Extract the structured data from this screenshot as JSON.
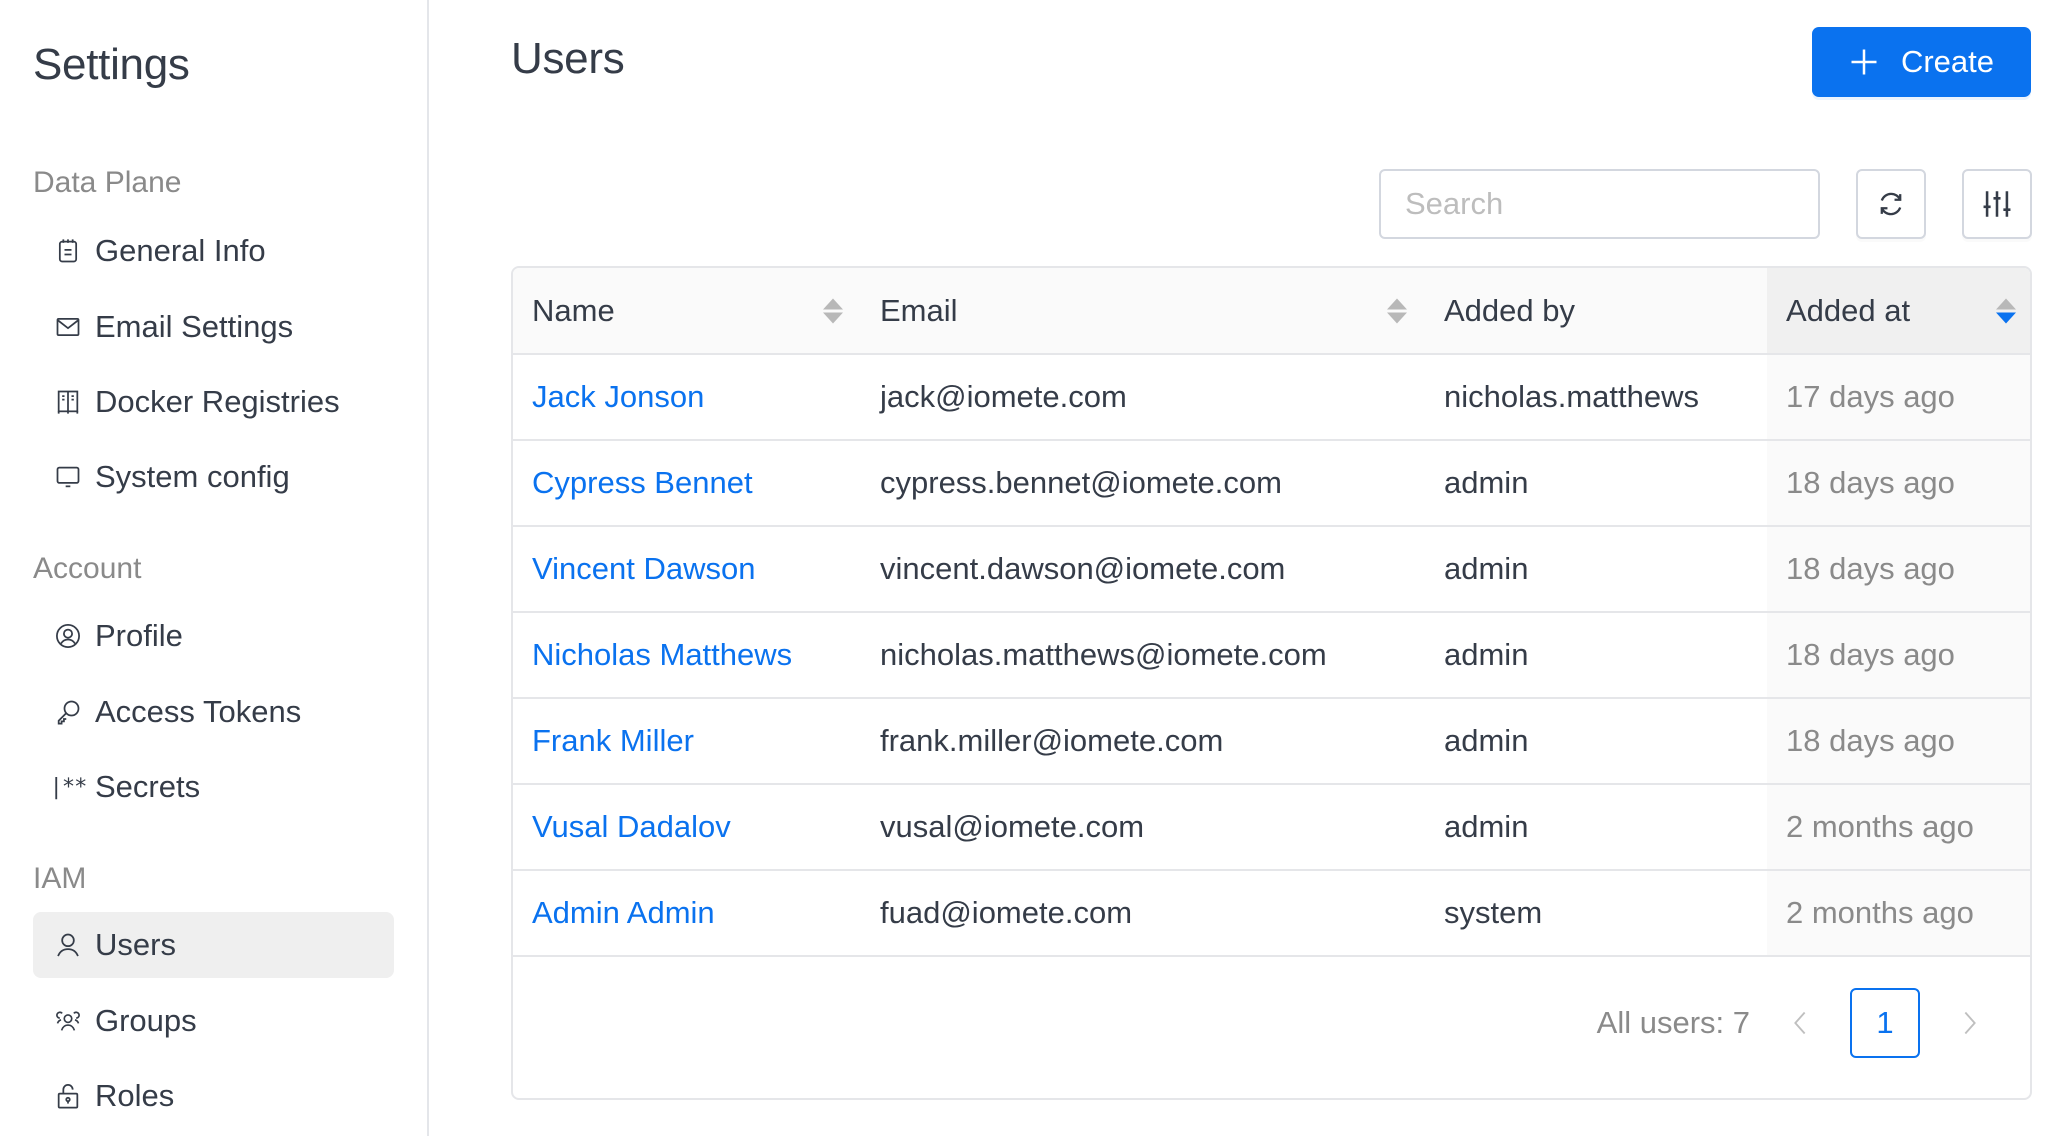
{
  "sidebar": {
    "title": "Settings",
    "sections": [
      {
        "label": "Data Plane",
        "items": [
          {
            "label": "General Info",
            "icon": "notepad-icon"
          },
          {
            "label": "Email Settings",
            "icon": "mail-icon"
          },
          {
            "label": "Docker Registries",
            "icon": "locker-icon"
          },
          {
            "label": "System config",
            "icon": "monitor-icon"
          }
        ]
      },
      {
        "label": "Account",
        "items": [
          {
            "label": "Profile",
            "icon": "user-circle-icon"
          },
          {
            "label": "Access Tokens",
            "icon": "key-icon"
          },
          {
            "label": "Secrets",
            "icon": "password-icon",
            "glyph": "|**"
          }
        ]
      },
      {
        "label": "IAM",
        "items": [
          {
            "label": "Users",
            "icon": "user-icon",
            "active": true
          },
          {
            "label": "Groups",
            "icon": "users-group-icon"
          },
          {
            "label": "Roles",
            "icon": "lock-icon"
          }
        ]
      }
    ]
  },
  "header": {
    "title": "Users",
    "create_label": "Create"
  },
  "toolbar": {
    "search_placeholder": "Search",
    "search_value": ""
  },
  "table": {
    "columns": [
      {
        "label": "Name",
        "sortable": true,
        "sort": "none"
      },
      {
        "label": "Email",
        "sortable": true,
        "sort": "none"
      },
      {
        "label": "Added by",
        "sortable": false
      },
      {
        "label": "Added at",
        "sortable": true,
        "sort": "descend"
      }
    ],
    "rows": [
      {
        "name": "Jack Jonson",
        "email": "jack@iomete.com",
        "added_by": "nicholas.matthews",
        "added_at": "17 days ago"
      },
      {
        "name": "Cypress Bennet",
        "email": "cypress.bennet@iomete.com",
        "added_by": "admin",
        "added_at": "18 days ago"
      },
      {
        "name": "Vincent Dawson",
        "email": "vincent.dawson@iomete.com",
        "added_by": "admin",
        "added_at": "18 days ago"
      },
      {
        "name": "Nicholas Matthews",
        "email": "nicholas.matthews@iomete.com",
        "added_by": "admin",
        "added_at": "18 days ago"
      },
      {
        "name": "Frank Miller",
        "email": "frank.miller@iomete.com",
        "added_by": "admin",
        "added_at": "18 days ago"
      },
      {
        "name": "Vusal Dadalov",
        "email": "vusal@iomete.com",
        "added_by": "admin",
        "added_at": "2 months ago"
      },
      {
        "name": "Admin Admin",
        "email": "fuad@iomete.com",
        "added_by": "system",
        "added_at": "2 months ago"
      }
    ]
  },
  "pagination": {
    "total_label": "All users: 7",
    "current_page": "1"
  },
  "colors": {
    "accent": "#0a72ef",
    "text": "#353c48",
    "muted": "#8a8a8a",
    "border": "#e5e6e9"
  }
}
